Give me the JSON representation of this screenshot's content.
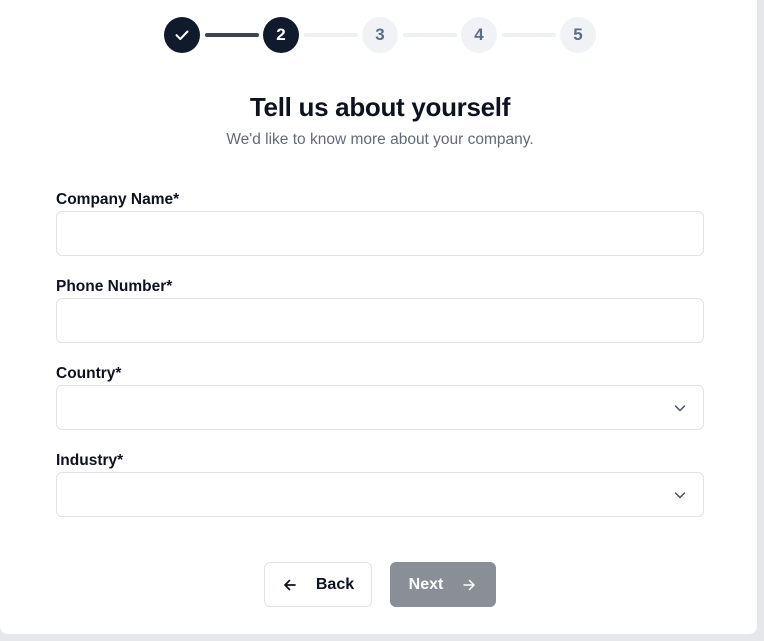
{
  "stepper": {
    "steps": [
      {
        "label": "",
        "state": "done",
        "icon": "check-icon"
      },
      {
        "label": "2",
        "state": "active"
      },
      {
        "label": "3",
        "state": "pending"
      },
      {
        "label": "4",
        "state": "pending"
      },
      {
        "label": "5",
        "state": "pending"
      }
    ]
  },
  "header": {
    "title": "Tell us about yourself",
    "subtitle": "We'd like to know more about your company."
  },
  "form": {
    "company_name": {
      "label": "Company Name*",
      "value": "",
      "placeholder": ""
    },
    "phone_number": {
      "label": "Phone Number*",
      "value": "",
      "placeholder": ""
    },
    "country": {
      "label": "Country*",
      "selected": "",
      "icon": "chevron-down-icon"
    },
    "industry": {
      "label": "Industry*",
      "selected": "",
      "icon": "chevron-down-icon"
    }
  },
  "actions": {
    "back_label": "Back",
    "back_icon": "arrow-left-icon",
    "next_label": "Next",
    "next_icon": "arrow-right-icon",
    "next_disabled": true
  },
  "colors": {
    "primary_dark": "#0f1b2d",
    "pending_step_bg": "#f0f2f6",
    "disabled_button": "#8a8e96"
  }
}
